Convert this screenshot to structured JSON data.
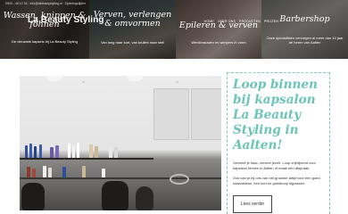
{
  "header": {
    "brand": "La Beauty Styling",
    "topbar_text": "0543 - 45 12 34  ·  info@labeautystyling.nl  ·  Openingstijden",
    "nav": [
      "HOME",
      "OVER ONS",
      "PRODUCTEN",
      "PRIJZEN"
    ]
  },
  "hero": {
    "panels": [
      {
        "title": "Wassen, knippen & föhnen",
        "subtitle": "De nieuwste kapsels bij La Beauty Styling"
      },
      {
        "title": "Verven, verlengen & omvormen",
        "subtitle": "Van lang naar kort, van krullen naar steil"
      },
      {
        "title": "Epileren & verven",
        "subtitle": "Wenkbrauwen en wimpers in vorm"
      },
      {
        "title": "Barbershop",
        "subtitle": "Onze specialisten verzorgen al meer dan 10 jaar de heren van Aalten"
      }
    ]
  },
  "main": {
    "title": "Loop binnen bij kapsalon La Beauty Styling in Aalten!",
    "paragraphs": [
      "Verveelt je haar, verveel jezelf. Loop vrijblijvend voor kapsalon binnen in Aalten of maak een afspraak.",
      "Ook kan je bij ons van het grootste altijd voor een goed haarcadeau, een kort en goedkoop bijpassen."
    ],
    "button": "Lees verder"
  },
  "colors": {
    "accent": "#6cc4b7",
    "text": "#333333"
  }
}
